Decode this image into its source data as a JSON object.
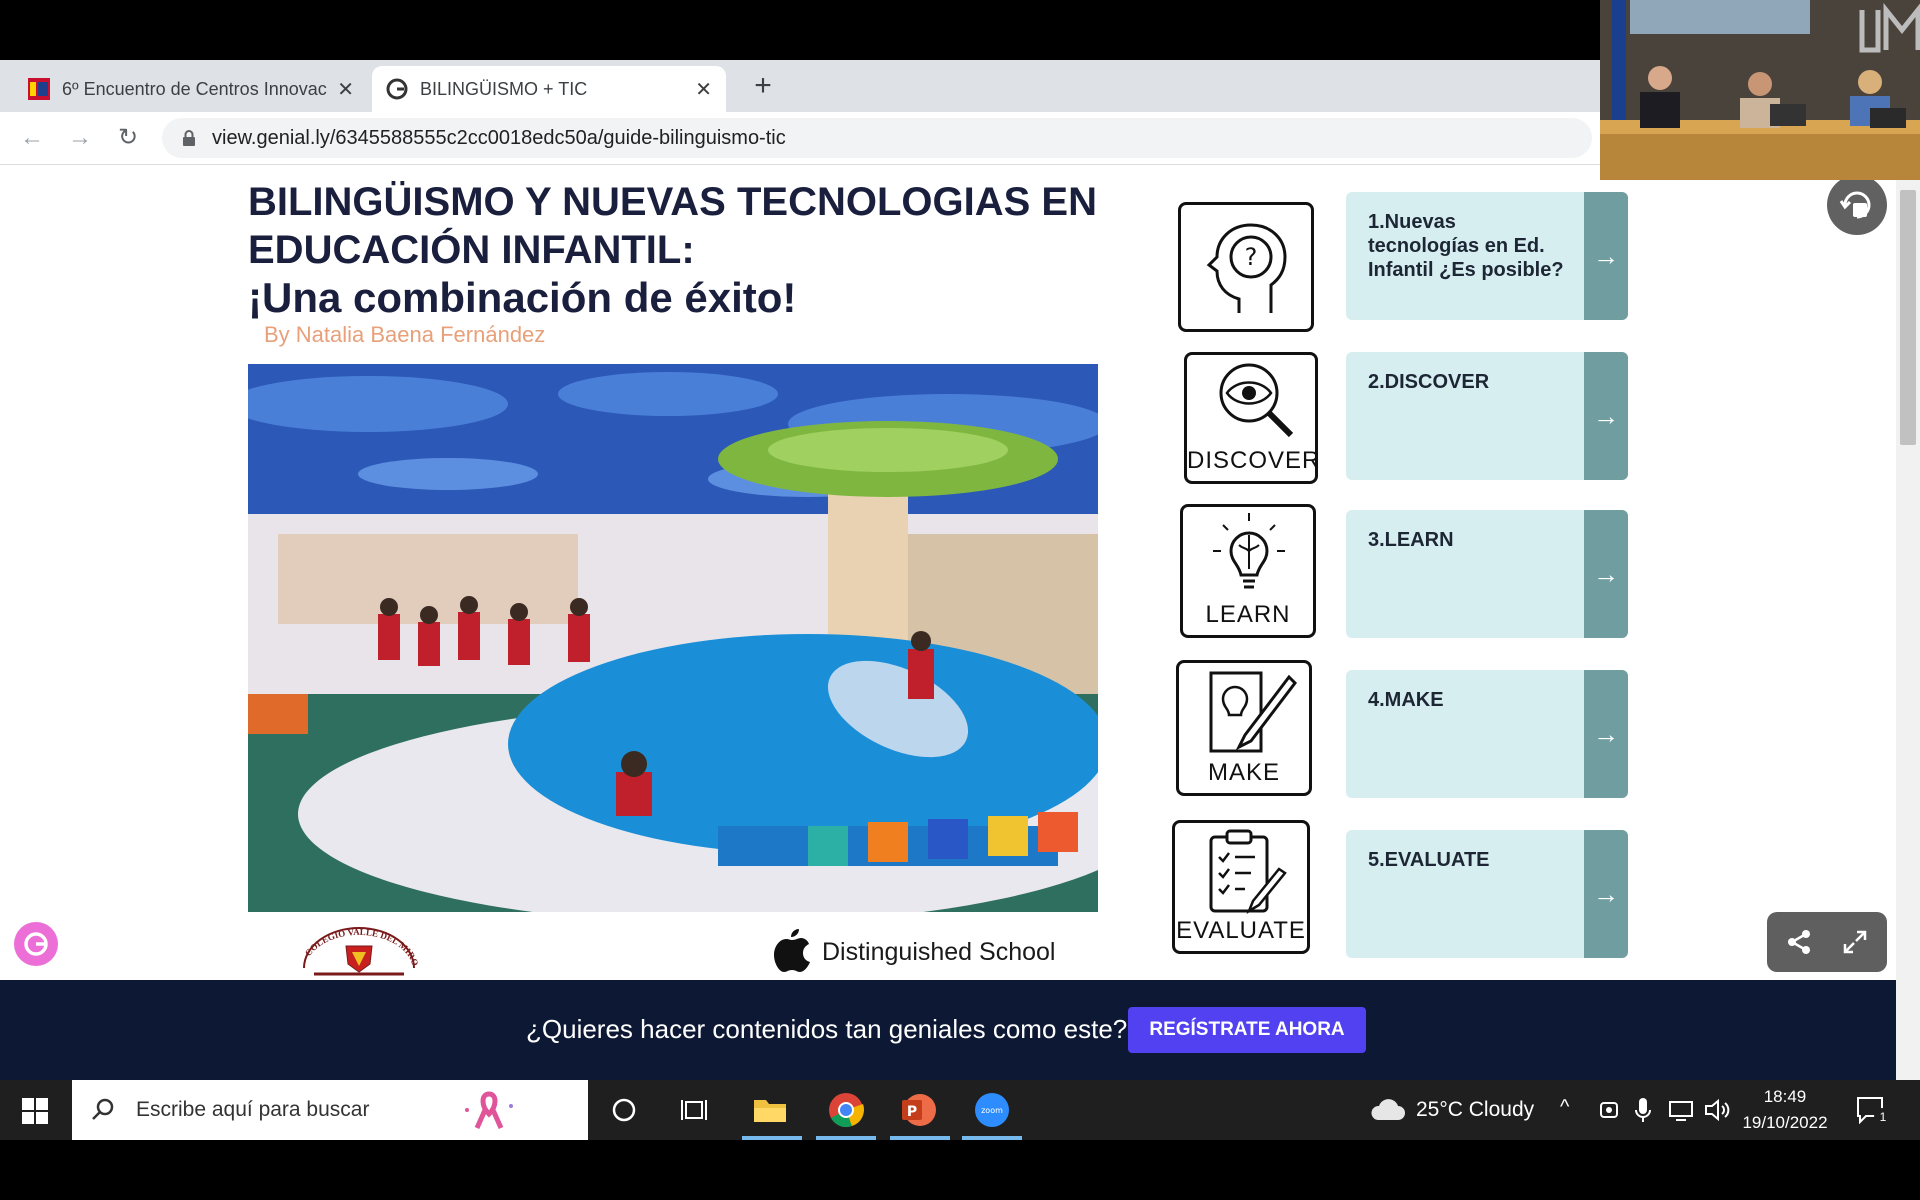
{
  "browser": {
    "tabs": [
      {
        "title": "6º Encuentro de Centros Innovac",
        "active": false
      },
      {
        "title": "BILINGÜISMO + TIC",
        "active": true
      }
    ],
    "url": "view.genial.ly/6345588555c2cc0018edc50a/guide-bilinguismo-tic"
  },
  "slide": {
    "title_line1": "BILINGÜISMO Y NUEVAS TECNOLOGIAS EN",
    "title_line2": "EDUCACIÓN INFANTIL:",
    "title_line3": "¡Una combinación de éxito!",
    "author": "By Natalia Baena Fernández",
    "school_logo_text": "COLEGIO VALLE DEL MIRO",
    "apple_badge": "Distinguished School",
    "menu": [
      {
        "icon": "head-question-icon",
        "icon_label": "",
        "card": "1.Nuevas tecnologías en Ed. Infantil ¿Es posible?"
      },
      {
        "icon": "eye-magnifier-icon",
        "icon_label": "DISCOVER",
        "card": "2.DISCOVER"
      },
      {
        "icon": "brain-bulb-icon",
        "icon_label": "LEARN",
        "card": "3.LEARN"
      },
      {
        "icon": "pencil-idea-icon",
        "icon_label": "MAKE",
        "card": "4.MAKE"
      },
      {
        "icon": "clipboard-check-icon",
        "icon_label": "EVALUATE",
        "card": "5.EVALUATE"
      }
    ]
  },
  "banner": {
    "question": "¿Quieres hacer contenidos tan geniales como este?",
    "cta": "REGÍSTRATE AHORA"
  },
  "taskbar": {
    "search_placeholder": "Escribe aquí para buscar",
    "weather": "25°C  Cloudy",
    "time": "18:49",
    "date": "19/10/2022",
    "notifications": "1"
  },
  "colors": {
    "banner_bg": "#0d1834",
    "cta_bg": "#5141f0",
    "card_bg": "#d7eef0",
    "card_arrow_bg": "#6f9da0",
    "title": "#1a1f3d",
    "author": "#e8a07b"
  }
}
